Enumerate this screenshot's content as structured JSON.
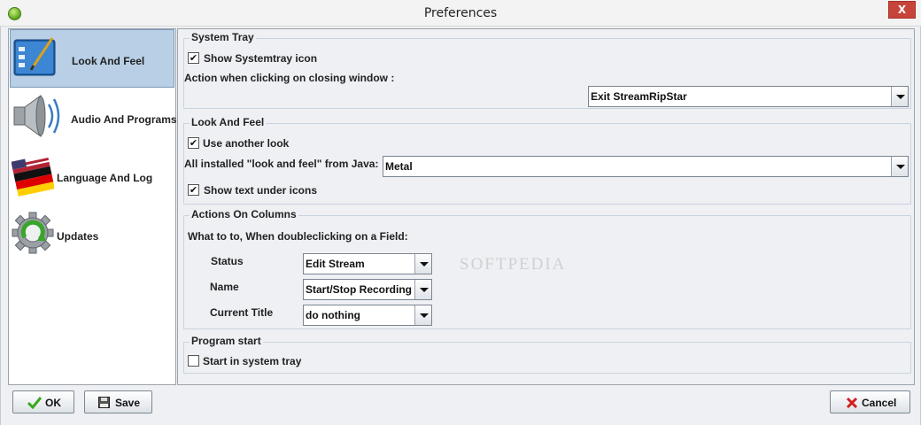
{
  "window": {
    "title": "Preferences",
    "close_label": "X"
  },
  "sidebar": {
    "items": [
      {
        "label": "Look And Feel",
        "icon": "look-and-feel-icon",
        "selected": true
      },
      {
        "label": "Audio And Programs",
        "icon": "speaker-icon",
        "selected": false
      },
      {
        "label": "Language And Log",
        "icon": "flag-icon",
        "selected": false
      },
      {
        "label": "Updates",
        "icon": "update-gear-icon",
        "selected": false
      }
    ]
  },
  "system_tray": {
    "title": "System Tray",
    "show_icon_label": "Show Systemtray icon",
    "show_icon_checked": true,
    "close_action_label": "Action when clicking on closing window :",
    "close_action_value": "Exit StreamRipStar"
  },
  "look_and_feel": {
    "title": "Look And Feel",
    "use_another_look_label": "Use another look",
    "use_another_look_checked": true,
    "installed_label": "All installed \"look and feel\" from Java:",
    "installed_value": "Metal",
    "show_text_label": "Show text under icons",
    "show_text_checked": true
  },
  "actions_on_columns": {
    "title": "Actions On Columns",
    "prompt": "What to to, When doubleclicking on a Field:",
    "rows": [
      {
        "label": "Status",
        "value": "Edit Stream"
      },
      {
        "label": "Name",
        "value": "Start/Stop Recording"
      },
      {
        "label": "Current Title",
        "value": "do nothing"
      }
    ]
  },
  "program_start": {
    "title": "Program start",
    "start_in_tray_label": "Start in system tray",
    "start_in_tray_checked": false
  },
  "buttons": {
    "ok": "OK",
    "save": "Save",
    "cancel": "Cancel"
  },
  "check_mark": "✔",
  "watermark_text": "SOFTPEDIA",
  "colors": {
    "selection": "#b8cfe5",
    "ok_check": "#3aa81e",
    "cancel_x": "#d21f1f"
  }
}
